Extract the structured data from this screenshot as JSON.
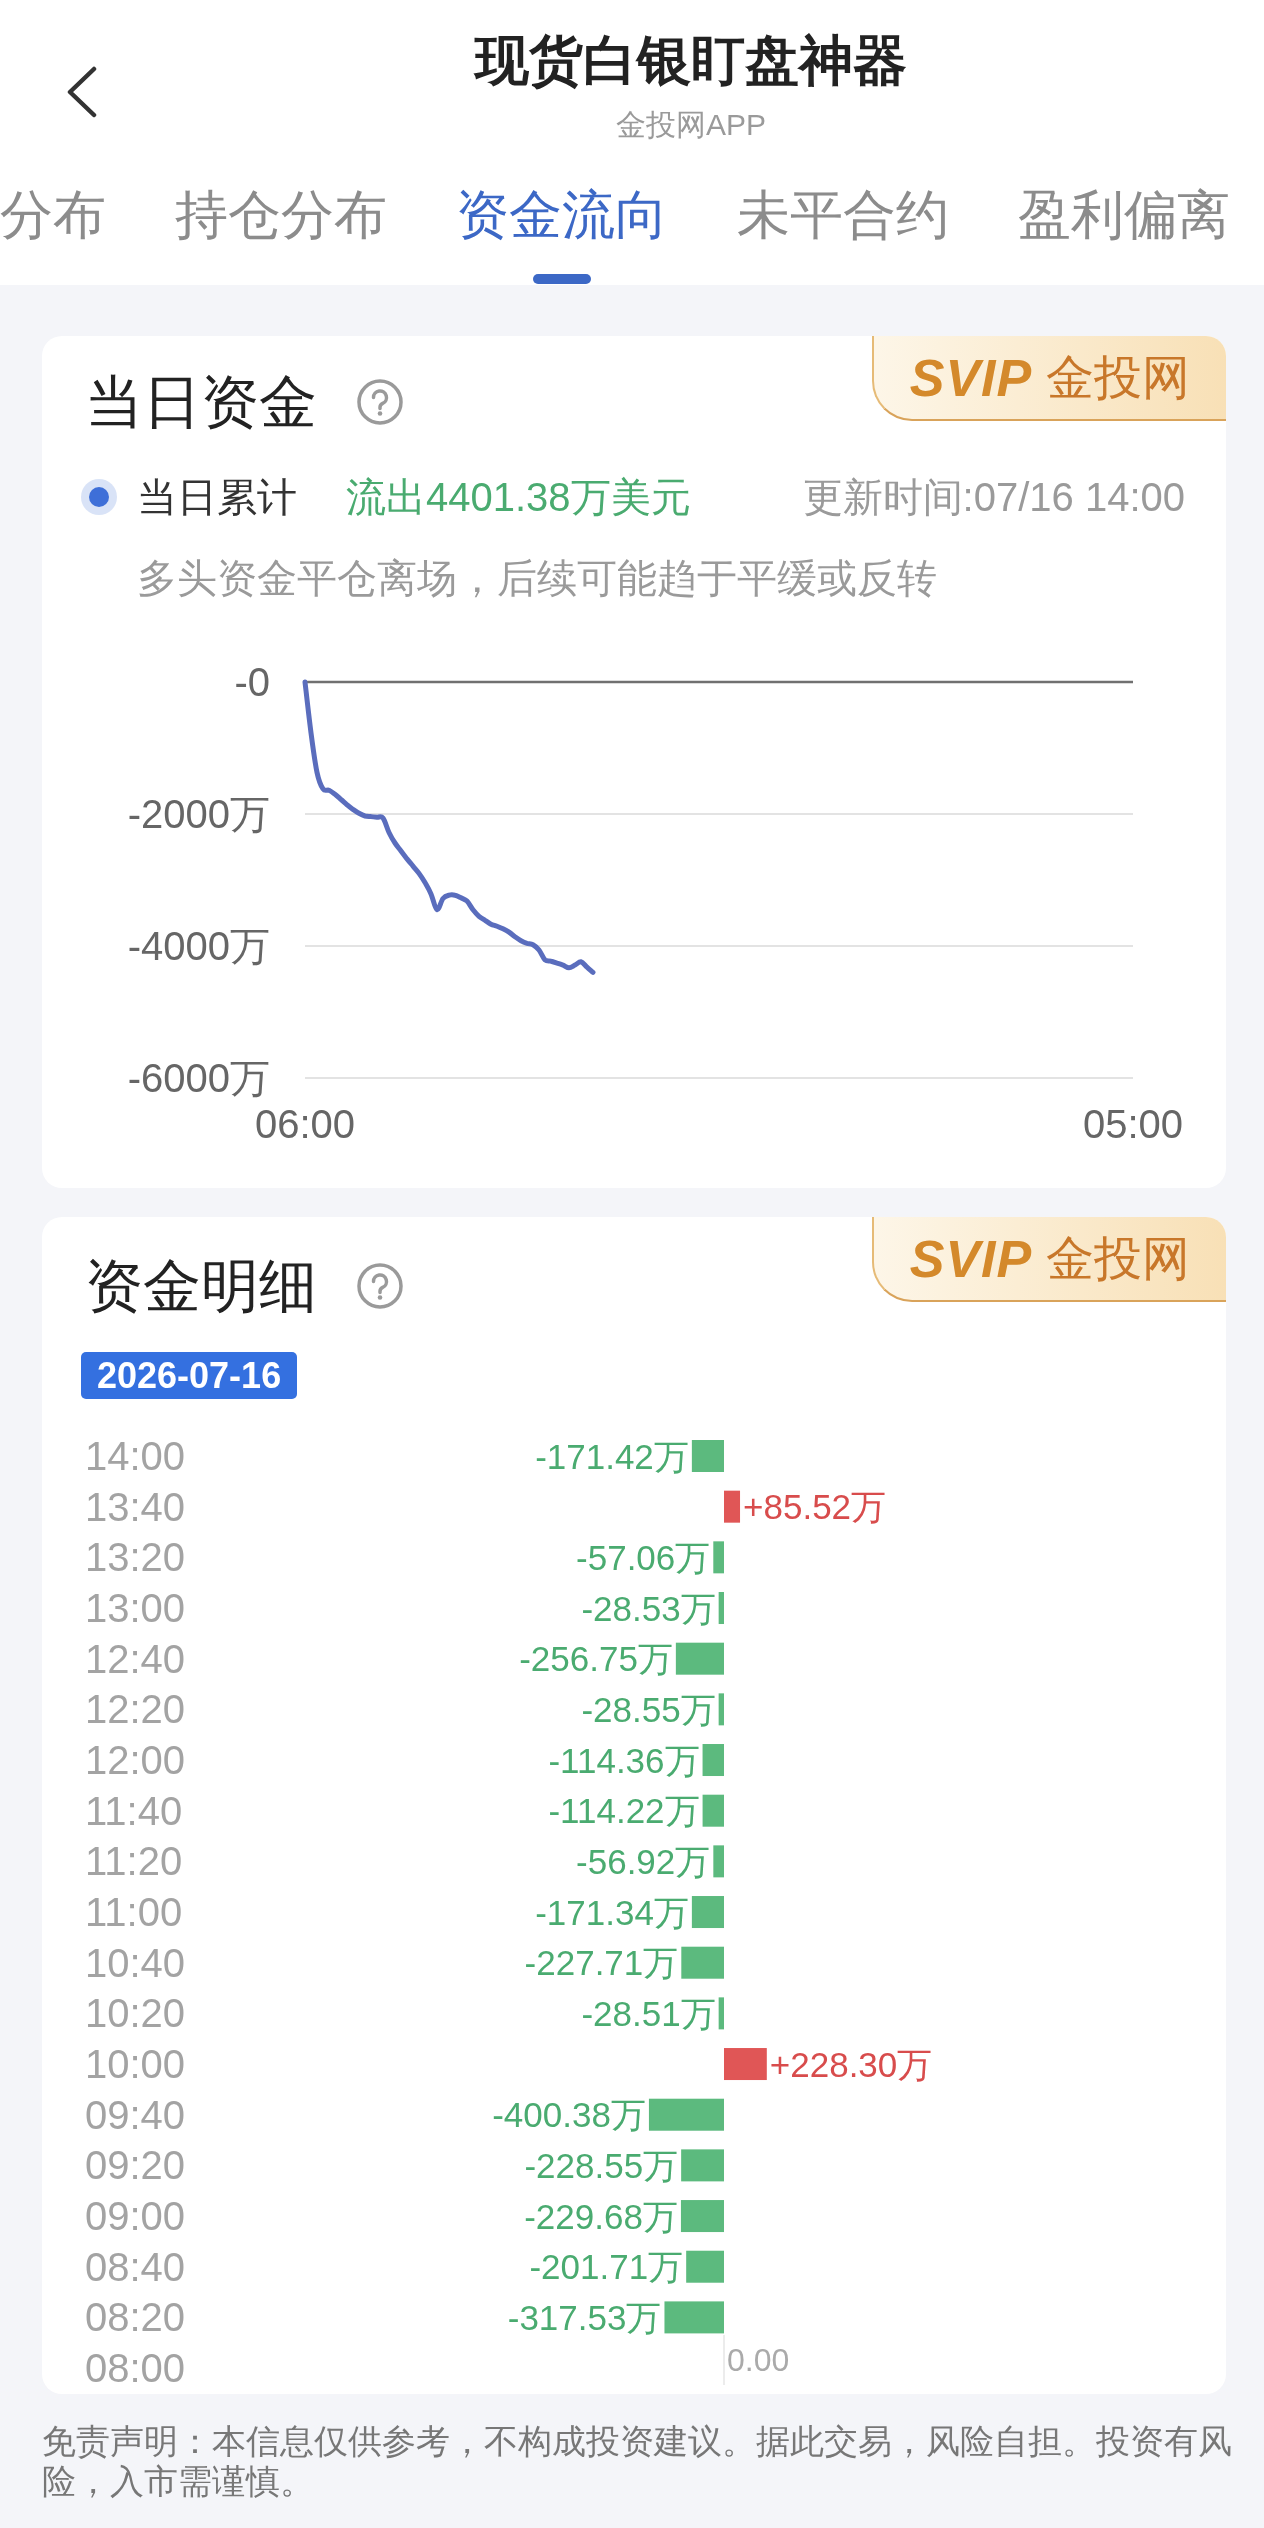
{
  "header": {
    "title": "现货白银盯盘神器",
    "subtitle": "金投网APP"
  },
  "tabs": [
    {
      "label": "分布",
      "selected": false
    },
    {
      "label": "持仓分布",
      "selected": false
    },
    {
      "label": "资金流向",
      "selected": true
    },
    {
      "label": "未平合约",
      "selected": false
    },
    {
      "label": "盈利偏离",
      "selected": false
    }
  ],
  "daily_funds": {
    "title": "当日资金",
    "badge": {
      "logo": "SVIP",
      "brand": "金投网"
    },
    "legend": {
      "label": "当日累计",
      "value": "流出4401.38万美元",
      "updated": "更新时间:07/16 14:00"
    },
    "note": "多头资金平仓离场，后续可能趋于平缓或反转",
    "chart_data": {
      "type": "line",
      "categories": [
        "06:00",
        null,
        null,
        null,
        null,
        null,
        null,
        null,
        null,
        null,
        null,
        null,
        null,
        null,
        null,
        null,
        null,
        null,
        null,
        null,
        null,
        null,
        null,
        null,
        null,
        null,
        null,
        null,
        null,
        null,
        null,
        null,
        null,
        null,
        null,
        null,
        null,
        null,
        null,
        null,
        null,
        null,
        null,
        null,
        null,
        null,
        null,
        null,
        null,
        null,
        null,
        null,
        null,
        null,
        null,
        null,
        null,
        null,
        null,
        null,
        null,
        null,
        null,
        null,
        null,
        null,
        null,
        null,
        null,
        null,
        null,
        null,
        null,
        null,
        null,
        null,
        null,
        null,
        null,
        null,
        null,
        null,
        null,
        null,
        null,
        null,
        null,
        null,
        null,
        null,
        null,
        null,
        null,
        null,
        null,
        null,
        null,
        null,
        null,
        null,
        null,
        null,
        null,
        null,
        null,
        null,
        null,
        null,
        null,
        null,
        null,
        null,
        null,
        null,
        null,
        null,
        null,
        null,
        null,
        null,
        null,
        null,
        null,
        null,
        null,
        null,
        null,
        null,
        null,
        null,
        null,
        null,
        null,
        null,
        null,
        null,
        null,
        null,
        "05:00"
      ],
      "series": [
        {
          "color": "#5a6dbd",
          "values": [
            0,
            -770,
            -1370,
            -1620,
            -1640,
            -1700,
            -1780,
            -1860,
            -1930,
            -1990,
            -2030,
            -2040,
            -2050,
            -2060,
            -2280,
            -2440,
            -2560,
            -2680,
            -2790,
            -2900,
            -3040,
            -3210,
            -3450,
            -3280,
            -3230,
            -3230,
            -3270,
            -3320,
            -3450,
            -3550,
            -3610,
            -3670,
            -3700,
            -3740,
            -3790,
            -3860,
            -3920,
            -3960,
            -3980,
            -4060,
            -4210,
            -4230,
            -4260,
            -4290,
            -4330,
            -4290,
            -4240,
            -4320,
            -4400,
            null,
            null,
            null,
            null,
            null,
            null,
            null,
            null,
            null,
            null,
            null,
            null,
            null,
            null,
            null,
            null,
            null,
            null,
            null,
            null,
            null,
            null,
            null,
            null,
            null,
            null,
            null,
            null,
            null,
            null,
            null,
            null,
            null,
            null,
            null,
            null,
            null,
            null,
            null,
            null,
            null,
            null,
            null,
            null,
            null,
            null,
            null,
            null,
            null,
            null,
            null,
            null,
            null,
            null,
            null,
            null,
            null,
            null,
            null,
            null,
            null,
            null,
            null,
            null,
            null,
            null,
            null,
            null,
            null,
            null,
            null,
            null,
            null,
            null,
            null,
            null,
            null,
            null,
            null,
            null,
            null,
            null,
            null,
            null,
            null,
            null,
            null,
            null,
            null,
            null
          ]
        }
      ],
      "ylim": [
        -6000,
        0
      ],
      "yticks": [
        {
          "value": 0,
          "label": "-0"
        },
        {
          "value": -2000,
          "label": "-2000万"
        },
        {
          "value": -4000,
          "label": "-4000万"
        },
        {
          "value": -6000,
          "label": "-6000万"
        }
      ]
    }
  },
  "fund_details": {
    "title": "资金明细",
    "badge": {
      "logo": "SVIP",
      "brand": "金投网"
    },
    "date": "2026-07-16",
    "zero_label": "0.00",
    "chart_data": {
      "type": "bar",
      "orientation": "horizontal",
      "categories": [
        "14:00",
        "13:40",
        "13:20",
        "13:00",
        "12:40",
        "12:20",
        "12:00",
        "11:40",
        "11:20",
        "11:00",
        "10:40",
        "10:20",
        "10:00",
        "09:40",
        "09:20",
        "09:00",
        "08:40",
        "08:20",
        "08:00"
      ],
      "values": [
        -171.42,
        85.52,
        -57.06,
        -28.53,
        -256.75,
        -28.55,
        -114.36,
        -114.22,
        -56.92,
        -171.34,
        -227.71,
        -28.51,
        228.3,
        -400.38,
        -228.55,
        -229.68,
        -201.71,
        -317.53,
        null
      ],
      "value_labels": [
        "-171.42万",
        "+85.52万",
        "-57.06万",
        "-28.53万",
        "-256.75万",
        "-28.55万",
        "-114.36万",
        "-114.22万",
        "-56.92万",
        "-171.34万",
        "-227.71万",
        "-28.51万",
        "+228.30万",
        "-400.38万",
        "-228.55万",
        "-229.68万",
        "-201.71万",
        "-317.53万",
        null
      ]
    }
  },
  "disclaimer": "免责声明：本信息仅供参考，不构成投资建议。据此交易，风险自担。投资有风险，入市需谨慎。"
}
